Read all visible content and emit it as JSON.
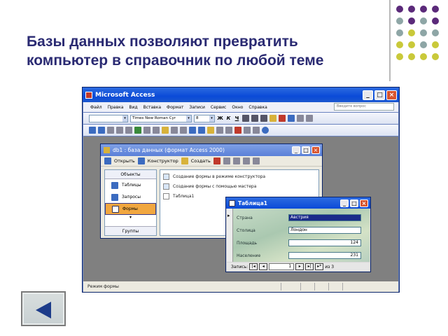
{
  "slide": {
    "title": "Базы данных позволяют превратить компьютер в справочник по любой теме",
    "dot_colors": [
      "#5b2a7a",
      "#5b2a7a",
      "#5b2a7a",
      "#5b2a7a",
      "#8ea6a6",
      "#5b2a7a",
      "#8ea6a6",
      "#5b2a7a",
      "#8ea6a6",
      "#c9c93a",
      "#8ea6a6",
      "#8ea6a6",
      "#c9c93a",
      "#c9c93a",
      "#8ea6a6",
      "#c9c93a",
      "#c9c93a",
      "#c9c93a",
      "#c9c93a",
      "#c9c93a"
    ]
  },
  "access": {
    "title": "Microsoft Access",
    "menu": [
      "Файл",
      "Правка",
      "Вид",
      "Вставка",
      "Формат",
      "Записи",
      "Сервис",
      "Окно",
      "Справка"
    ],
    "ask_placeholder": "Введите вопрос",
    "font_name": "Times New Roman Cyr",
    "font_size": "8",
    "format_labels": [
      "Ж",
      "К",
      "Ч"
    ],
    "status_text": "Режим формы"
  },
  "db1": {
    "title": "db1 : база данных (формат Access 2000)",
    "toolbar": [
      "Открыть",
      "Конструктор",
      "Создать"
    ],
    "objects_header": "Объекты",
    "objects": [
      "Таблицы",
      "Запросы",
      "Формы"
    ],
    "selected_object": "Формы",
    "groups_label": "Группы",
    "items": [
      "Создание формы в режиме конструктора",
      "Создание формы с помощью мастера",
      "Таблица1"
    ]
  },
  "form": {
    "title": "Таблица1",
    "fields": [
      {
        "label": "Страна",
        "value": "Австрия"
      },
      {
        "label": "Столица",
        "value": "Лондон"
      },
      {
        "label": "Площадь",
        "value": "124"
      },
      {
        "label": "Население",
        "value": "231"
      }
    ],
    "nav_label": "Запись:",
    "record_number": "1",
    "of_label": "из 3"
  },
  "nav": {
    "back_icon": "triangle-left-icon"
  }
}
